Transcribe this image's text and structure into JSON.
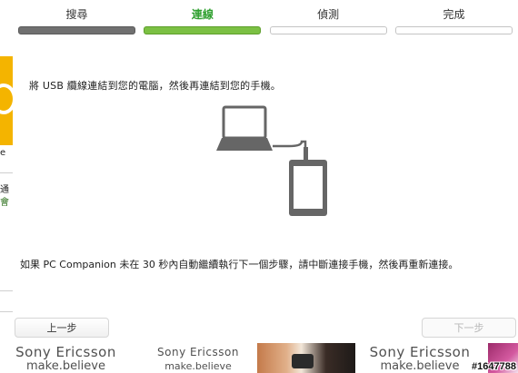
{
  "wizard": {
    "steps": [
      {
        "label": "搜尋",
        "state": "done"
      },
      {
        "label": "連線",
        "state": "current"
      },
      {
        "label": "偵測",
        "state": "pending"
      },
      {
        "label": "完成",
        "state": "pending"
      }
    ],
    "instruction": "將 USB 纜線連結到您的電腦，然後再連結到您的手機。",
    "note": "如果 PC Companion 未在 30 秒內自動繼續執行下一個步驟，請中斷連接手機，然後再重新連接。",
    "prev_label": "上一步",
    "next_label": "下一步",
    "colors": {
      "current": "#7bc043",
      "done": "#707070",
      "illustration": "#666666"
    }
  },
  "background": {
    "left_text_1": "e",
    "left_text_2": "通",
    "left_text_3": "會"
  },
  "ads": [
    {
      "brand": "Sony Ericsson",
      "slogan": "make.believe"
    },
    {
      "brand": "Sony Ericsson",
      "slogan": "make.believe"
    },
    {
      "brand": "Sony Ericsson",
      "slogan": "make.believe"
    }
  ],
  "watermark": "#1647788"
}
